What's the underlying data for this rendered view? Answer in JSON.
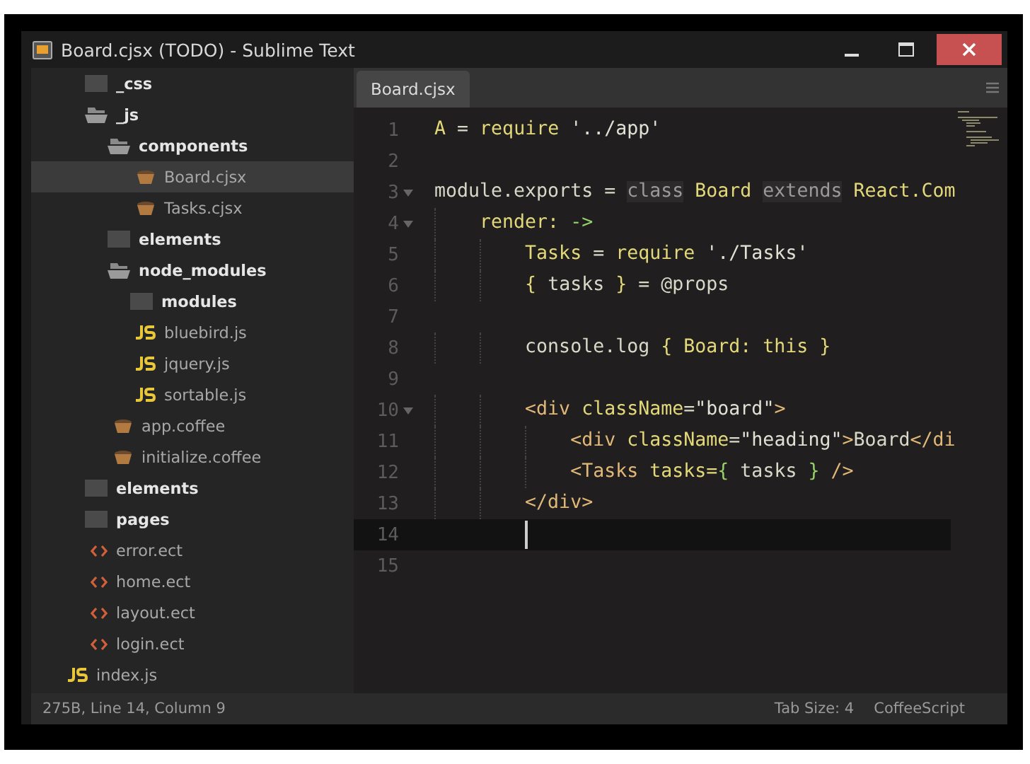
{
  "window": {
    "title": "Board.cjsx (TODO) - Sublime Text"
  },
  "sidebar": {
    "items": [
      {
        "kind": "continued",
        "children": [
          {
            "kind": "folder",
            "label": "_css",
            "expanded": false,
            "selected": false
          },
          {
            "kind": "folder",
            "label": "_js",
            "expanded": true,
            "selected": false,
            "children": [
              {
                "kind": "folder",
                "label": "components",
                "expanded": true,
                "selected": false,
                "children": [
                  {
                    "kind": "coffee",
                    "label": "Board.cjsx",
                    "selected": true
                  },
                  {
                    "kind": "coffee",
                    "label": "Tasks.cjsx",
                    "selected": false
                  }
                ]
              },
              {
                "kind": "folder",
                "label": "elements",
                "expanded": false,
                "selected": false
              },
              {
                "kind": "folder",
                "label": "node_modules",
                "expanded": true,
                "selected": false,
                "children": [
                  {
                    "kind": "folder",
                    "label": "modules",
                    "expanded": false,
                    "selected": false
                  },
                  {
                    "kind": "js",
                    "label": "bluebird.js",
                    "selected": false
                  },
                  {
                    "kind": "js",
                    "label": "jquery.js",
                    "selected": false
                  },
                  {
                    "kind": "js",
                    "label": "sortable.js",
                    "selected": false
                  }
                ]
              },
              {
                "kind": "coffee",
                "label": "app.coffee",
                "selected": false
              },
              {
                "kind": "coffee",
                "label": "initialize.coffee",
                "selected": false
              }
            ]
          },
          {
            "kind": "folder",
            "label": "elements",
            "expanded": false,
            "selected": false
          },
          {
            "kind": "folder",
            "label": "pages",
            "expanded": false,
            "selected": false
          },
          {
            "kind": "ect",
            "label": "error.ect",
            "selected": false
          },
          {
            "kind": "ect",
            "label": "home.ect",
            "selected": false
          },
          {
            "kind": "ect",
            "label": "layout.ect",
            "selected": false
          },
          {
            "kind": "ect",
            "label": "login.ect",
            "selected": false
          }
        ]
      },
      {
        "kind": "js",
        "label": "index.js",
        "selected": false
      }
    ]
  },
  "tabs": [
    {
      "label": "Board.cjsx",
      "selected": true
    }
  ],
  "editor": {
    "lines": [
      {
        "number": "1",
        "foldable": false,
        "current": false,
        "tokens": [
          {
            "kind": "ident",
            "text": "A"
          },
          {
            "kind": "plain",
            "text": " = "
          },
          {
            "kind": "ident",
            "text": "require"
          },
          {
            "kind": "string",
            "text": " '../app'"
          }
        ]
      },
      {
        "number": "2",
        "foldable": false,
        "current": false
      },
      {
        "number": "3",
        "foldable": true,
        "current": false,
        "tokens": [
          {
            "kind": "plain",
            "text": "module.exports = "
          },
          {
            "kind": "keyword",
            "text": "class"
          },
          {
            "kind": "ident",
            "text": " Board "
          },
          {
            "kind": "keyword",
            "text": "extends"
          },
          {
            "kind": "ident",
            "text": " React.Com"
          }
        ]
      },
      {
        "number": "4",
        "foldable": true,
        "current": false,
        "tokens": [
          {
            "kind": "ident",
            "text": "    render: "
          },
          {
            "kind": "arrow",
            "text": "->"
          }
        ]
      },
      {
        "number": "5",
        "foldable": false,
        "current": false,
        "tokens": [
          {
            "kind": "ident",
            "text": "        Tasks"
          },
          {
            "kind": "plain",
            "text": " = "
          },
          {
            "kind": "ident",
            "text": "require"
          },
          {
            "kind": "string",
            "text": " './Tasks'"
          }
        ]
      },
      {
        "number": "6",
        "foldable": false,
        "current": false,
        "tokens": [
          {
            "kind": "ident",
            "text": "        {"
          },
          {
            "kind": "plain",
            "text": " tasks "
          },
          {
            "kind": "ident",
            "text": "}"
          },
          {
            "kind": "plain",
            "text": " = @props"
          }
        ]
      },
      {
        "number": "7",
        "foldable": false,
        "current": false
      },
      {
        "number": "8",
        "foldable": false,
        "current": false,
        "tokens": [
          {
            "kind": "plain",
            "text": "        console.log "
          },
          {
            "kind": "ident",
            "text": "{ Board: this }"
          }
        ]
      },
      {
        "number": "9",
        "foldable": false,
        "current": false
      },
      {
        "number": "10",
        "foldable": true,
        "current": false,
        "tokens": [
          {
            "kind": "tag",
            "text": "        <div"
          },
          {
            "kind": "ident",
            "text": " className"
          },
          {
            "kind": "plain",
            "text": "="
          },
          {
            "kind": "string",
            "text": "\"board\""
          },
          {
            "kind": "tag",
            "text": ">"
          }
        ]
      },
      {
        "number": "11",
        "foldable": false,
        "current": false,
        "tokens": [
          {
            "kind": "tag",
            "text": "            <div"
          },
          {
            "kind": "ident",
            "text": " className"
          },
          {
            "kind": "plain",
            "text": "="
          },
          {
            "kind": "string",
            "text": "\"heading\""
          },
          {
            "kind": "tag",
            "text": ">"
          },
          {
            "kind": "plain",
            "text": "Board"
          },
          {
            "kind": "tag",
            "text": "</di"
          }
        ]
      },
      {
        "number": "12",
        "foldable": false,
        "current": false,
        "tokens": [
          {
            "kind": "tag",
            "text": "            <Tasks"
          },
          {
            "kind": "ident",
            "text": " tasks="
          },
          {
            "kind": "arrow",
            "text": "{"
          },
          {
            "kind": "plain",
            "text": " tasks "
          },
          {
            "kind": "arrow",
            "text": "}"
          },
          {
            "kind": "tag",
            "text": " />"
          }
        ]
      },
      {
        "number": "13",
        "foldable": false,
        "current": false,
        "tokens": [
          {
            "kind": "tag",
            "text": "        </div>"
          }
        ]
      },
      {
        "number": "14",
        "foldable": false,
        "current": true
      },
      {
        "number": "15",
        "foldable": false,
        "current": false
      }
    ]
  },
  "status_bar": {
    "position": "275B, Line 14, Column 9",
    "tab_size": "Tab Size: 4",
    "syntax": "CoffeeScript"
  }
}
